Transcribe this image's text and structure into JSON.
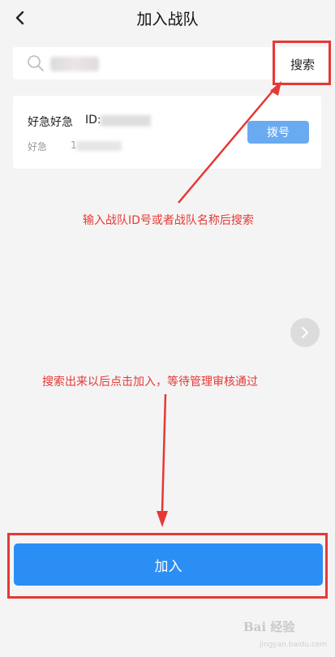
{
  "header": {
    "title": "加入战队"
  },
  "search": {
    "placeholder": "",
    "button_label": "搜索"
  },
  "result": {
    "team_name": "好急好急",
    "id_label": "ID:",
    "sub_label": "好急",
    "sub_value": "1",
    "dial_label": "拨号"
  },
  "annotations": {
    "search_hint": "输入战队ID号或者战队名称后搜索",
    "join_hint": "搜索出来以后点击加入，等待管理审核通过"
  },
  "actions": {
    "join_label": "加入"
  },
  "watermark": {
    "text": "Bai 经验",
    "sub": "jingyan.baidu.com"
  },
  "colors": {
    "accent": "#2a8ef5",
    "dial": "#6aaaf0",
    "annotation": "#e53935",
    "background": "#f4f4f4"
  }
}
